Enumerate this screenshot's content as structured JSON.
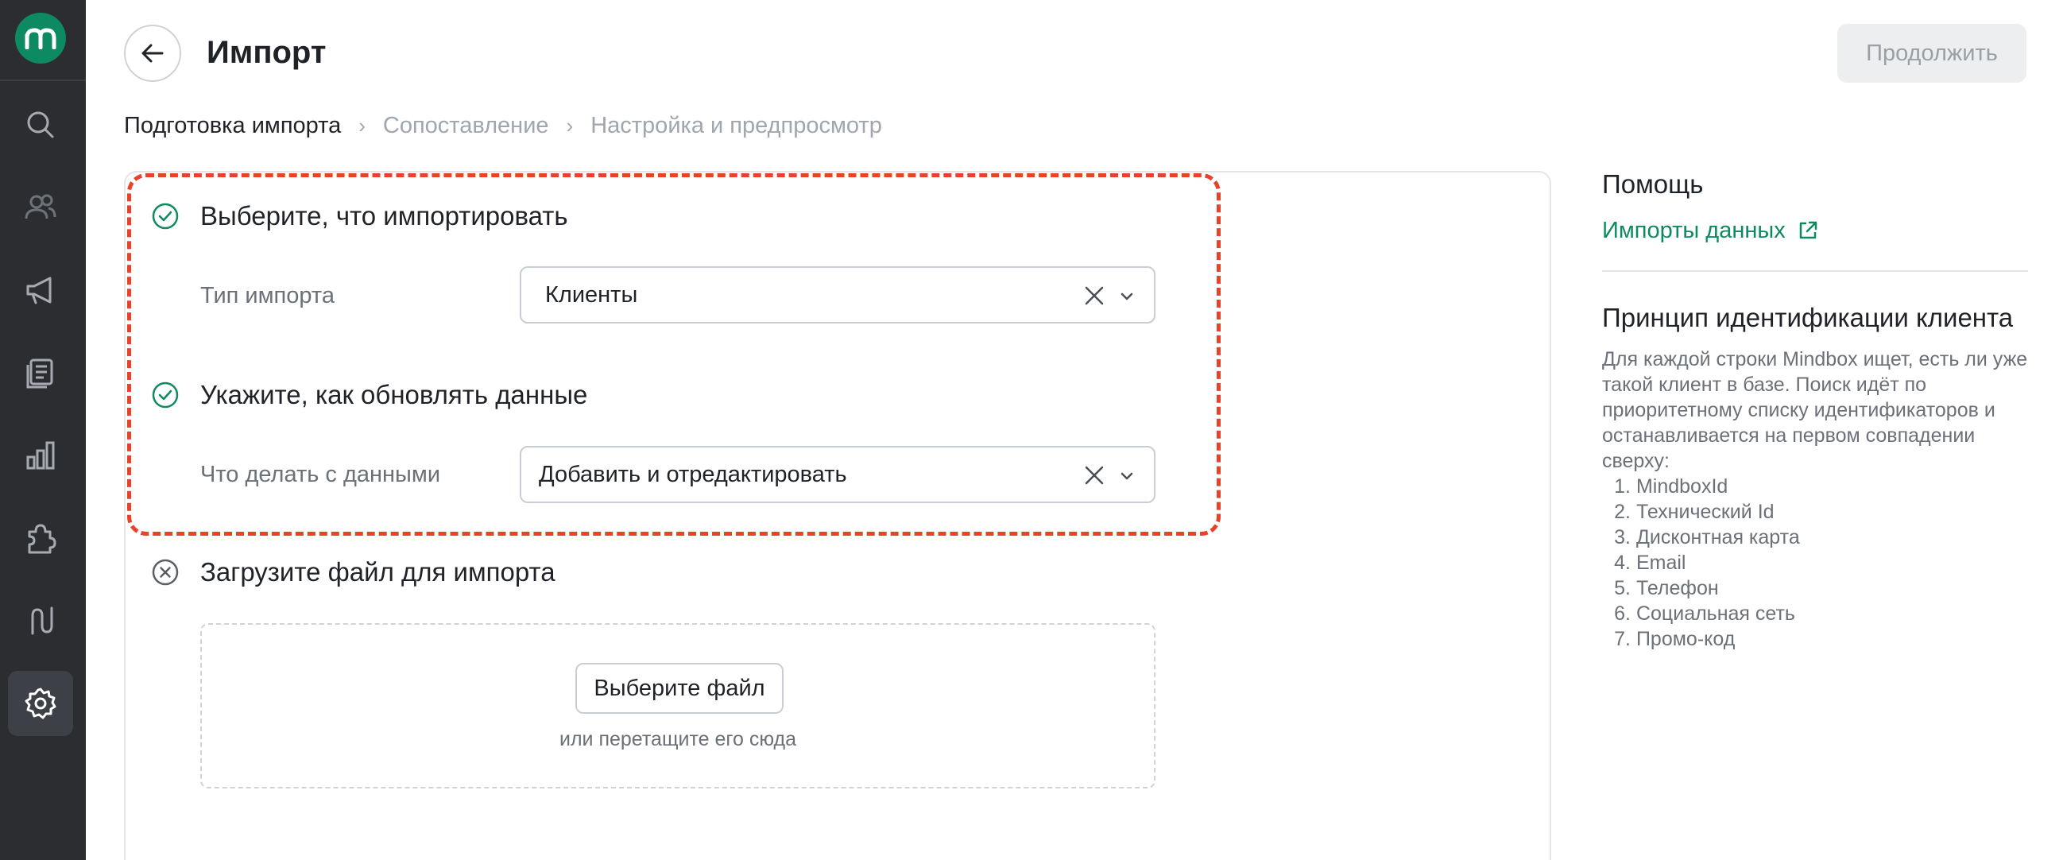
{
  "app": {
    "logo_letter": "m",
    "accent": "#0e8a63"
  },
  "sidebar": {
    "items": [
      {
        "id": "search",
        "icon": "search-icon"
      },
      {
        "id": "customers",
        "icon": "users-icon"
      },
      {
        "id": "campaigns",
        "icon": "megaphone-icon"
      },
      {
        "id": "content",
        "icon": "documents-icon"
      },
      {
        "id": "analytics",
        "icon": "bar-chart-icon"
      },
      {
        "id": "integrations",
        "icon": "puzzle-icon"
      },
      {
        "id": "scenarios",
        "icon": "flow-icon"
      },
      {
        "id": "settings",
        "icon": "gear-icon",
        "active": true
      }
    ]
  },
  "header": {
    "title": "Импорт",
    "continue_label": "Продолжить"
  },
  "breadcrumb": {
    "steps": [
      "Подготовка импорта",
      "Сопоставление",
      "Настройка и предпросмотр"
    ]
  },
  "form": {
    "step1": {
      "title": "Выберите, что импортировать",
      "status": "done",
      "field_label": "Тип импорта",
      "field_value": "Клиенты"
    },
    "step2": {
      "title": "Укажите, как обновлять данные",
      "status": "done",
      "field_label": "Что делать с данными",
      "field_value": "Добавить и отредактировать"
    },
    "step3": {
      "title": "Загрузите файл для импорта",
      "status": "pending",
      "button_label": "Выберите файл",
      "hint": "или перетащите его сюда"
    }
  },
  "help": {
    "title": "Помощь",
    "link_label": "Импорты данных",
    "subtitle": "Принцип идентификации клиента",
    "text": "Для каждой строки Mindbox ищет, есть ли уже такой клиент в базе. Поиск идёт по приоритетному списку идентификаторов и останавливается на первом совпадении сверху:",
    "list": [
      {
        "n": "1.",
        "label": "MindboxId"
      },
      {
        "n": "2.",
        "label": "Технический Id"
      },
      {
        "n": "3.",
        "label": "Дисконтная карта"
      },
      {
        "n": "4.",
        "label": "Email"
      },
      {
        "n": "5.",
        "label": "Телефон"
      },
      {
        "n": "6.",
        "label": "Социальная сеть"
      },
      {
        "n": "7.",
        "label": "Промо-код"
      }
    ]
  }
}
